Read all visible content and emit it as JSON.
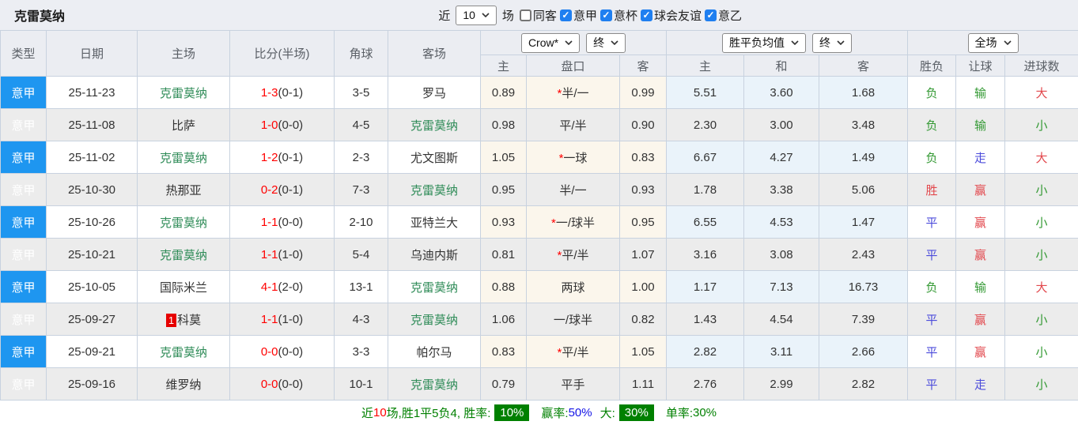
{
  "topbar": {
    "team": "克雷莫纳",
    "near_label": "近",
    "count_select": "10",
    "games_label": "场",
    "filters": [
      {
        "label": "同客",
        "checked": false
      },
      {
        "label": "意甲",
        "checked": true
      },
      {
        "label": "意杯",
        "checked": true
      },
      {
        "label": "球会友谊",
        "checked": true
      },
      {
        "label": "意乙",
        "checked": true
      }
    ]
  },
  "table": {
    "headers": {
      "type": "类型",
      "date": "日期",
      "home": "主场",
      "score": "比分(半场)",
      "corners": "角球",
      "away": "客场",
      "ah_home": "主",
      "ah_line": "盘口",
      "ah_away": "客",
      "eu_home": "主",
      "eu_draw": "和",
      "eu_away": "客",
      "result": "胜负",
      "handicap_result": "让球",
      "goals": "进球数"
    },
    "selects": {
      "company": "Crow*",
      "company_time": "终",
      "europe": "胜平负均值",
      "europe_time": "终",
      "scope": "全场"
    },
    "rows": [
      {
        "league": "意甲",
        "date": "25-11-23",
        "home": {
          "name": "克雷莫纳",
          "green": true
        },
        "score": {
          "main": "1-3",
          "half": "(0-1)"
        },
        "corners": "3-5",
        "away": {
          "name": "罗马",
          "green": false
        },
        "ah": {
          "home": "0.89",
          "star": true,
          "line": "半/一",
          "away": "0.99"
        },
        "eu": {
          "home": "5.51",
          "draw": "3.60",
          "away": "1.68"
        },
        "result": {
          "text": "负",
          "color": "green"
        },
        "handicap_res": {
          "text": "输",
          "color": "green"
        },
        "goals": {
          "text": "大",
          "color": "red"
        }
      },
      {
        "league": "意甲",
        "date": "25-11-08",
        "home": {
          "name": "比萨",
          "green": false
        },
        "score": {
          "main": "1-0",
          "half": "(0-0)"
        },
        "corners": "4-5",
        "away": {
          "name": "克雷莫纳",
          "green": true
        },
        "ah": {
          "home": "0.98",
          "star": false,
          "line": "平/半",
          "away": "0.90"
        },
        "eu": {
          "home": "2.30",
          "draw": "3.00",
          "away": "3.48"
        },
        "result": {
          "text": "负",
          "color": "green"
        },
        "handicap_res": {
          "text": "输",
          "color": "green"
        },
        "goals": {
          "text": "小",
          "color": "green"
        }
      },
      {
        "league": "意甲",
        "date": "25-11-02",
        "home": {
          "name": "克雷莫纳",
          "green": true
        },
        "score": {
          "main": "1-2",
          "half": "(0-1)"
        },
        "corners": "2-3",
        "away": {
          "name": "尤文图斯",
          "green": false
        },
        "ah": {
          "home": "1.05",
          "star": true,
          "line": "一球",
          "away": "0.83"
        },
        "eu": {
          "home": "6.67",
          "draw": "4.27",
          "away": "1.49"
        },
        "result": {
          "text": "负",
          "color": "green"
        },
        "handicap_res": {
          "text": "走",
          "color": "blue"
        },
        "goals": {
          "text": "大",
          "color": "red"
        }
      },
      {
        "league": "意甲",
        "date": "25-10-30",
        "home": {
          "name": "热那亚",
          "green": false
        },
        "score": {
          "main": "0-2",
          "half": "(0-1)"
        },
        "corners": "7-3",
        "away": {
          "name": "克雷莫纳",
          "green": true
        },
        "ah": {
          "home": "0.95",
          "star": false,
          "line": "半/一",
          "away": "0.93"
        },
        "eu": {
          "home": "1.78",
          "draw": "3.38",
          "away": "5.06"
        },
        "result": {
          "text": "胜",
          "color": "red"
        },
        "handicap_res": {
          "text": "赢",
          "color": "red"
        },
        "goals": {
          "text": "小",
          "color": "green"
        }
      },
      {
        "league": "意甲",
        "date": "25-10-26",
        "home": {
          "name": "克雷莫纳",
          "green": true
        },
        "score": {
          "main": "1-1",
          "half": "(0-0)"
        },
        "corners": "2-10",
        "away": {
          "name": "亚特兰大",
          "green": false
        },
        "ah": {
          "home": "0.93",
          "star": true,
          "line": "一/球半",
          "away": "0.95"
        },
        "eu": {
          "home": "6.55",
          "draw": "4.53",
          "away": "1.47"
        },
        "result": {
          "text": "平",
          "color": "blue"
        },
        "handicap_res": {
          "text": "赢",
          "color": "red"
        },
        "goals": {
          "text": "小",
          "color": "green"
        }
      },
      {
        "league": "意甲",
        "date": "25-10-21",
        "home": {
          "name": "克雷莫纳",
          "green": true
        },
        "score": {
          "main": "1-1",
          "half": "(1-0)"
        },
        "corners": "5-4",
        "away": {
          "name": "乌迪内斯",
          "green": false
        },
        "ah": {
          "home": "0.81",
          "star": true,
          "line": "平/半",
          "away": "1.07"
        },
        "eu": {
          "home": "3.16",
          "draw": "3.08",
          "away": "2.43"
        },
        "result": {
          "text": "平",
          "color": "blue"
        },
        "handicap_res": {
          "text": "赢",
          "color": "red"
        },
        "goals": {
          "text": "小",
          "color": "green"
        }
      },
      {
        "league": "意甲",
        "date": "25-10-05",
        "home": {
          "name": "国际米兰",
          "green": false
        },
        "score": {
          "main": "4-1",
          "half": "(2-0)"
        },
        "corners": "13-1",
        "away": {
          "name": "克雷莫纳",
          "green": true
        },
        "ah": {
          "home": "0.88",
          "star": false,
          "line": "两球",
          "away": "1.00"
        },
        "eu": {
          "home": "1.17",
          "draw": "7.13",
          "away": "16.73"
        },
        "result": {
          "text": "负",
          "color": "green"
        },
        "handicap_res": {
          "text": "输",
          "color": "green"
        },
        "goals": {
          "text": "大",
          "color": "red"
        }
      },
      {
        "league": "意甲",
        "date": "25-09-27",
        "home": {
          "name": "科莫",
          "green": false,
          "rank": "1"
        },
        "score": {
          "main": "1-1",
          "half": "(1-0)"
        },
        "corners": "4-3",
        "away": {
          "name": "克雷莫纳",
          "green": true
        },
        "ah": {
          "home": "1.06",
          "star": false,
          "line": "一/球半",
          "away": "0.82"
        },
        "eu": {
          "home": "1.43",
          "draw": "4.54",
          "away": "7.39"
        },
        "result": {
          "text": "平",
          "color": "blue"
        },
        "handicap_res": {
          "text": "赢",
          "color": "red"
        },
        "goals": {
          "text": "小",
          "color": "green"
        }
      },
      {
        "league": "意甲",
        "date": "25-09-21",
        "home": {
          "name": "克雷莫纳",
          "green": true
        },
        "score": {
          "main": "0-0",
          "half": "(0-0)"
        },
        "corners": "3-3",
        "away": {
          "name": "帕尔马",
          "green": false
        },
        "ah": {
          "home": "0.83",
          "star": true,
          "line": "平/半",
          "away": "1.05"
        },
        "eu": {
          "home": "2.82",
          "draw": "3.11",
          "away": "2.66"
        },
        "result": {
          "text": "平",
          "color": "blue"
        },
        "handicap_res": {
          "text": "赢",
          "color": "red"
        },
        "goals": {
          "text": "小",
          "color": "green"
        }
      },
      {
        "league": "意甲",
        "date": "25-09-16",
        "home": {
          "name": "维罗纳",
          "green": false
        },
        "score": {
          "main": "0-0",
          "half": "(0-0)"
        },
        "corners": "10-1",
        "away": {
          "name": "克雷莫纳",
          "green": true
        },
        "ah": {
          "home": "0.79",
          "star": false,
          "line": "平手",
          "away": "1.11"
        },
        "eu": {
          "home": "2.76",
          "draw": "2.99",
          "away": "2.82"
        },
        "result": {
          "text": "平",
          "color": "blue"
        },
        "handicap_res": {
          "text": "走",
          "color": "blue"
        },
        "goals": {
          "text": "小",
          "color": "green"
        }
      }
    ]
  },
  "summary": {
    "segments": [
      {
        "text": "近",
        "color": "green"
      },
      {
        "text": "10",
        "color": "red"
      },
      {
        "text": "场,胜1平5负4, 胜率:",
        "color": "green"
      },
      {
        "text": "10%",
        "badge": true
      },
      {
        "text": "赢率:",
        "color": "green",
        "gap": true
      },
      {
        "text": "50%",
        "color": "blue"
      },
      {
        "text": "大:",
        "color": "green",
        "gap": true
      },
      {
        "text": "30%",
        "badge": true
      },
      {
        "text": "单率:",
        "color": "green",
        "gap": true
      },
      {
        "text": "30%",
        "color": "green"
      }
    ]
  },
  "colors": {
    "type_column_blue": "#1E96F0",
    "team_green": "#2E8B57",
    "score_red": "#FF0000",
    "result_red": "#E2484D",
    "result_green": "#339933",
    "result_blue": "#4B4BDB",
    "badge_green": "#008000",
    "checkbox_blue": "#1F7FF0",
    "handicap_col_bg": "#FBF6EC",
    "odds_col_bg": "#EAF3FA"
  }
}
